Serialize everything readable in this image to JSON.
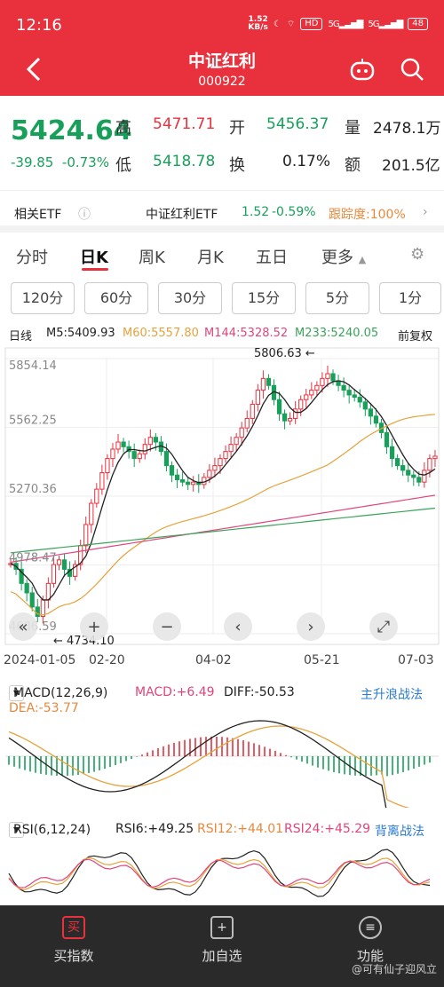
{
  "status": {
    "time": "12:16",
    "speed_top": "1.52",
    "speed_bottom": "KB/s",
    "battery": "48",
    "net1": "5G",
    "net2": "5G",
    "hd": "HD"
  },
  "header": {
    "title": "中证红利",
    "code": "000922"
  },
  "quote": {
    "price": "5424.64",
    "change": "-39.85",
    "change_pct": "-0.73%",
    "high_label": "高",
    "high": "5471.71",
    "open_label": "开",
    "open": "5456.37",
    "vol_label": "量",
    "vol": "2478.1万",
    "low_label": "低",
    "low": "5418.78",
    "turn_label": "换",
    "turn": "0.17%",
    "amt_label": "额",
    "amt": "201.5亿"
  },
  "etf": {
    "label": "相关ETF",
    "name": "中证红利ETF",
    "price": "1.52",
    "pct": "-0.59%",
    "track": "跟踪度:100%"
  },
  "tabs": [
    "分时",
    "日K",
    "周K",
    "月K",
    "五日",
    "更多"
  ],
  "periods": [
    "120分",
    "60分",
    "30分",
    "15分",
    "5分",
    "1分"
  ],
  "ma": {
    "line": "日线",
    "m5": "M5:5409.93",
    "m60": "M60:5557.80",
    "m144": "M144:5328.52",
    "m233": "M233:5240.05",
    "adj": "前复权"
  },
  "colors": {
    "red": "#e8313c",
    "green": "#18a05a",
    "m5": "#222222",
    "m60": "#e6a23c",
    "m144": "#e0457b",
    "m233": "#3aa35a"
  },
  "chart_data": {
    "type": "candlestick",
    "y_ticks": [
      "5854.14",
      "5562.25",
      "5270.36",
      "4978.47",
      "4686.59"
    ],
    "x_ticks": [
      "2024-01-05",
      "02-20",
      "04-02",
      "05-21",
      "07-03"
    ],
    "high_mark": "5806.63",
    "low_mark": "4734.10",
    "ylim": [
      4686.59,
      5854.14
    ],
    "closes": [
      4985,
      4960,
      4900,
      4860,
      4800,
      4760,
      4830,
      4900,
      4980,
      5000,
      4960,
      4930,
      4980,
      5060,
      5150,
      5240,
      5300,
      5370,
      5430,
      5470,
      5500,
      5480,
      5460,
      5430,
      5450,
      5490,
      5520,
      5500,
      5460,
      5400,
      5360,
      5340,
      5330,
      5320,
      5330,
      5320,
      5350,
      5380,
      5400,
      5430,
      5460,
      5490,
      5520,
      5560,
      5600,
      5660,
      5720,
      5770,
      5740,
      5680,
      5620,
      5590,
      5600,
      5640,
      5680,
      5700,
      5720,
      5740,
      5770,
      5790,
      5760,
      5740,
      5720,
      5700,
      5690,
      5670,
      5640,
      5610,
      5580,
      5540,
      5480,
      5430,
      5400,
      5380,
      5360,
      5350,
      5330,
      5380,
      5430,
      5440
    ]
  },
  "macd": {
    "label": "MACD(12,26,9)",
    "macd": "MACD:+6.49",
    "diff": "DIFF:-50.53",
    "dea": "DEA:-53.77",
    "strategy": "主升浪战法"
  },
  "rsi": {
    "label": "RSI(6,12,24)",
    "r6": "RSI6:+49.25",
    "r12": "RSI12:+44.01",
    "r24": "RSI24:+45.29",
    "strategy": "背离战法"
  },
  "chart_controls": [
    "«",
    "+",
    "−",
    "‹",
    "›",
    "⤢"
  ],
  "bottom": {
    "buy": "买指数",
    "add": "加自选",
    "func": "功能",
    "buy_icon": "买",
    "watermark": "@可有仙子迎风立"
  }
}
